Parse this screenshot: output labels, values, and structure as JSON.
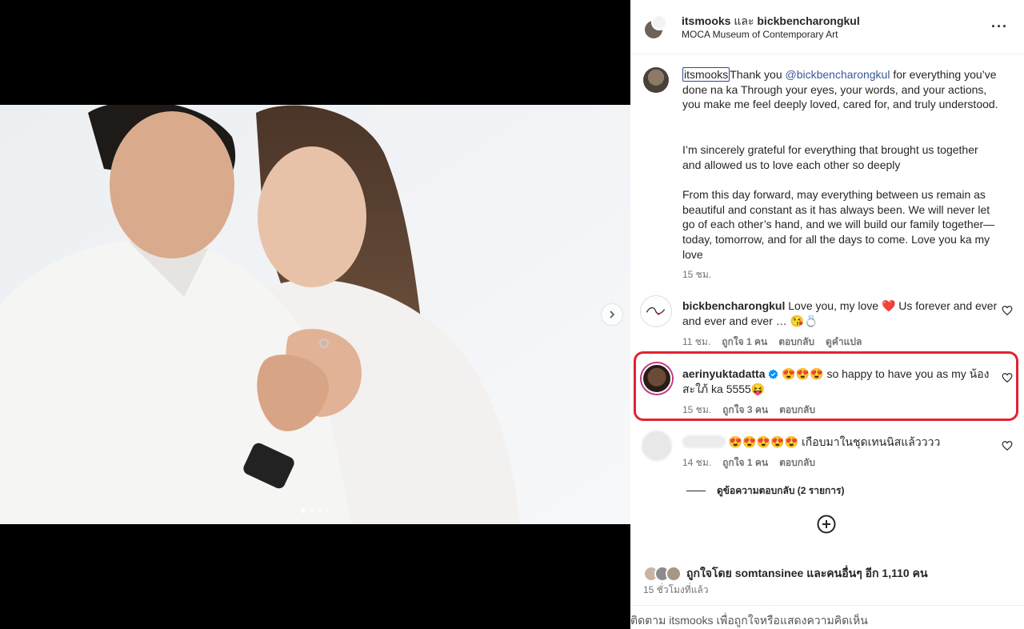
{
  "post": {
    "author": "itsmooks",
    "and_word": "และ",
    "coauthor": "bickbencharongkul",
    "location": "MOCA Museum of Contemporary Art"
  },
  "caption": {
    "username": "itsmooks",
    "text_1a": "Thank you ",
    "mention": "@bickbencharongkul",
    "text_1b": " for everything you’ve done na ka Through your eyes, your words, and your actions, you make me feel deeply loved, cared for, and truly understood.",
    "text_2": "I’m sincerely grateful for everything that brought us together and allowed us to love each other so deeply",
    "text_3": "From this day forward, may everything between us remain as beautiful and constant as it has always been. We will never let go of each other’s hand, and we will build our family together—today, tomorrow, and for all the days to come. Love you ka my love",
    "time": "15 ชม."
  },
  "comments": [
    {
      "username": "bickbencharongkul",
      "text": "Love you, my love ❤️ Us forever and ever and ever and ever … 😘💍",
      "time": "11 ชม.",
      "likes": "ถูกใจ 1 คน",
      "reply": "ตอบกลับ",
      "translate": "ดูคำแปล"
    },
    {
      "username": "aerinyuktadatta",
      "text": "😍😍😍 so happy to have you as my น้องสะใภ้ ka 5555😝",
      "time": "15 ชม.",
      "likes": "ถูกใจ 3 คน",
      "reply": "ตอบกลับ"
    },
    {
      "text": "😍😍😍😍😍 เกือบมาในชุดเทนนิสแล้วววว",
      "time": "14 ชม.",
      "likes": "ถูกใจ 1 คน",
      "reply": "ตอบกลับ",
      "view_replies": "ดูข้อความตอบกลับ (2 รายการ)"
    }
  ],
  "likes": {
    "prefix": "ถูกใจโดย",
    "user": "somtansinee",
    "suffix": "และคนอื่นๆ อีก",
    "count": "1,110",
    "unit": "คน"
  },
  "posted_ago": "15 ชั่วโมงที่แล้ว",
  "footer_text": "ติดตาม itsmooks เพื่อถูกใจหรือแสดงความคิดเห็น",
  "icons": [
    "more-icon",
    "next-arrow-icon",
    "heart-icon",
    "verified-icon",
    "add-circle-icon"
  ],
  "carousel": {
    "total": 4,
    "current": 1
  },
  "colors": {
    "mention": "#3b5998",
    "highlight": "#e0242f",
    "verified": "#0095f6"
  }
}
